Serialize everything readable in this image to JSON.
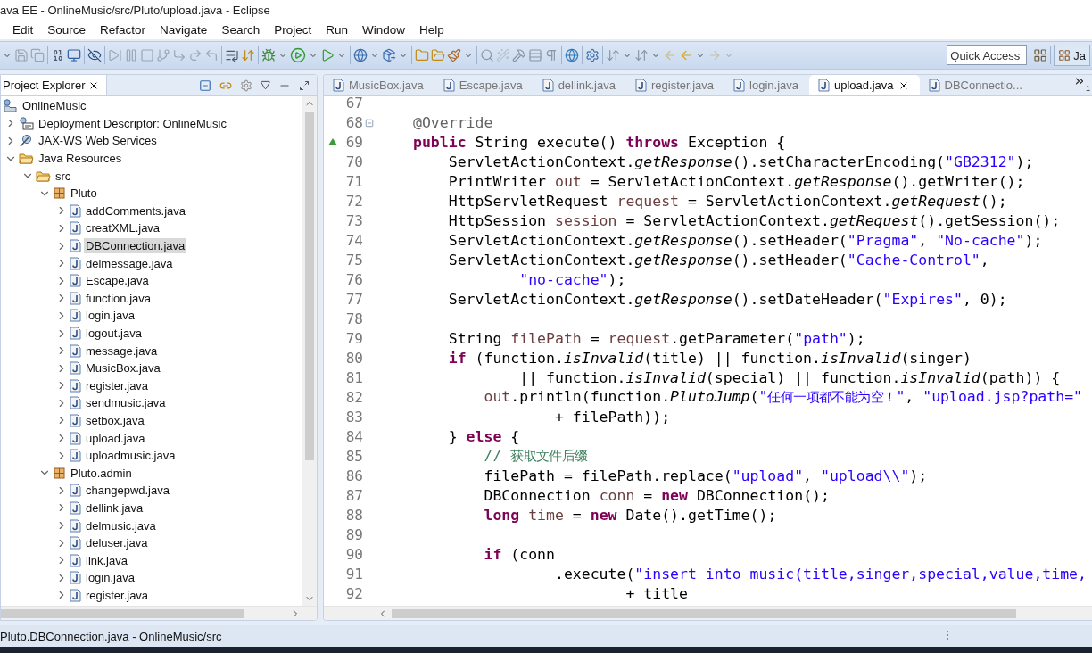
{
  "window": {
    "title": "ava EE - OnlineMusic/src/Pluto/upload.java - Eclipse"
  },
  "menu": [
    "Edit",
    "Source",
    "Refactor",
    "Navigate",
    "Search",
    "Project",
    "Run",
    "Window",
    "Help"
  ],
  "toolbar": {
    "quick_access": {
      "placeholder": "Quick Access"
    },
    "perspective": "Ja"
  },
  "explorer": {
    "title": "Project Explorer",
    "tree": [
      {
        "label": "OnlineMusic",
        "kind": "project",
        "selected": false,
        "children": [
          {
            "label": "Deployment Descriptor: OnlineMusic",
            "kind": "descriptor",
            "expanded": false,
            "selected": false
          },
          {
            "label": "JAX-WS Web Services",
            "kind": "services",
            "expanded": false,
            "selected": false
          },
          {
            "label": "Java Resources",
            "kind": "resources",
            "expanded": true,
            "selected": false,
            "children": [
              {
                "label": "src",
                "kind": "folder",
                "expanded": true,
                "selected": false,
                "children": [
                  {
                    "label": "Pluto",
                    "kind": "package",
                    "expanded": true,
                    "selected": false,
                    "children": [
                      {
                        "label": "addComments.java",
                        "kind": "file",
                        "expanded": false,
                        "selected": false
                      },
                      {
                        "label": "creatXML.java",
                        "kind": "file",
                        "expanded": false,
                        "selected": false
                      },
                      {
                        "label": "DBConnection.java",
                        "kind": "file",
                        "expanded": false,
                        "selected": true
                      },
                      {
                        "label": "delmessage.java",
                        "kind": "file",
                        "expanded": false,
                        "selected": false
                      },
                      {
                        "label": "Escape.java",
                        "kind": "file",
                        "expanded": false,
                        "selected": false
                      },
                      {
                        "label": "function.java",
                        "kind": "file",
                        "expanded": false,
                        "selected": false
                      },
                      {
                        "label": "login.java",
                        "kind": "file",
                        "expanded": false,
                        "selected": false
                      },
                      {
                        "label": "logout.java",
                        "kind": "file",
                        "expanded": false,
                        "selected": false
                      },
                      {
                        "label": "message.java",
                        "kind": "file",
                        "expanded": false,
                        "selected": false
                      },
                      {
                        "label": "MusicBox.java",
                        "kind": "file",
                        "expanded": false,
                        "selected": false
                      },
                      {
                        "label": "register.java",
                        "kind": "file",
                        "expanded": false,
                        "selected": false
                      },
                      {
                        "label": "sendmusic.java",
                        "kind": "file",
                        "expanded": false,
                        "selected": false
                      },
                      {
                        "label": "setbox.java",
                        "kind": "file",
                        "expanded": false,
                        "selected": false
                      },
                      {
                        "label": "upload.java",
                        "kind": "file",
                        "expanded": false,
                        "selected": false
                      },
                      {
                        "label": "uploadmusic.java",
                        "kind": "file",
                        "expanded": false,
                        "selected": false
                      }
                    ]
                  },
                  {
                    "label": "Pluto.admin",
                    "kind": "package",
                    "expanded": true,
                    "selected": false,
                    "children": [
                      {
                        "label": "changepwd.java",
                        "kind": "file",
                        "expanded": false,
                        "selected": false
                      },
                      {
                        "label": "dellink.java",
                        "kind": "file",
                        "expanded": false,
                        "selected": false
                      },
                      {
                        "label": "delmusic.java",
                        "kind": "file",
                        "expanded": false,
                        "selected": false
                      },
                      {
                        "label": "deluser.java",
                        "kind": "file",
                        "expanded": false,
                        "selected": false
                      },
                      {
                        "label": "link.java",
                        "kind": "file",
                        "expanded": false,
                        "selected": false
                      },
                      {
                        "label": "login.java",
                        "kind": "file",
                        "expanded": false,
                        "selected": false
                      },
                      {
                        "label": "register.java",
                        "kind": "file",
                        "expanded": false,
                        "selected": false
                      }
                    ]
                  }
                ]
              }
            ]
          }
        ]
      }
    ]
  },
  "editor": {
    "tabs": [
      {
        "label": "MusicBox.java",
        "selected": false
      },
      {
        "label": "Escape.java",
        "selected": false
      },
      {
        "label": "dellink.java",
        "selected": false
      },
      {
        "label": "register.java",
        "selected": false
      },
      {
        "label": "login.java",
        "selected": false
      },
      {
        "label": "upload.java",
        "selected": true
      },
      {
        "label": "DBConnectio...",
        "selected": false
      }
    ],
    "hidden_tabs": "1",
    "lines": [
      {
        "number": "67",
        "kind": "code"
      },
      {
        "number": "68",
        "kind": "fold",
        "tokens": [
          {
            "kind": "annotation",
            "text": "@Override"
          }
        ]
      },
      {
        "number": "69",
        "kind": "override",
        "tokens": [
          {
            "kind": "keyword",
            "text": "public"
          },
          {
            "kind": "plain",
            "text": " String execute() "
          },
          {
            "kind": "keyword",
            "text": "throws"
          },
          {
            "kind": "plain",
            "text": " Exception {"
          }
        ]
      },
      {
        "number": "70",
        "kind": "code",
        "tokens": [
          {
            "kind": "plain",
            "text": "    ServletActionContext."
          },
          {
            "kind": "static",
            "text": "getResponse"
          },
          {
            "kind": "plain",
            "text": "().setCharacterEncoding("
          },
          {
            "kind": "string",
            "text": "\"GB2312\""
          },
          {
            "kind": "plain",
            "text": ");"
          }
        ]
      },
      {
        "number": "71",
        "kind": "code",
        "tokens": [
          {
            "kind": "plain",
            "text": "    PrintWriter "
          },
          {
            "kind": "variable",
            "text": "out"
          },
          {
            "kind": "plain",
            "text": " = ServletActionContext."
          },
          {
            "kind": "static",
            "text": "getResponse"
          },
          {
            "kind": "plain",
            "text": "().getWriter();"
          }
        ]
      },
      {
        "number": "72",
        "kind": "code",
        "tokens": [
          {
            "kind": "plain",
            "text": "    HttpServletRequest "
          },
          {
            "kind": "variable",
            "text": "request"
          },
          {
            "kind": "plain",
            "text": " = ServletActionContext."
          },
          {
            "kind": "static",
            "text": "getRequest"
          },
          {
            "kind": "plain",
            "text": "();"
          }
        ]
      },
      {
        "number": "73",
        "kind": "code",
        "tokens": [
          {
            "kind": "plain",
            "text": "    HttpSession "
          },
          {
            "kind": "variable",
            "text": "session"
          },
          {
            "kind": "plain",
            "text": " = ServletActionContext."
          },
          {
            "kind": "static",
            "text": "getRequest"
          },
          {
            "kind": "plain",
            "text": "().getSession();"
          }
        ]
      },
      {
        "number": "74",
        "kind": "code",
        "tokens": [
          {
            "kind": "plain",
            "text": "    ServletActionContext."
          },
          {
            "kind": "static",
            "text": "getResponse"
          },
          {
            "kind": "plain",
            "text": "().setHeader("
          },
          {
            "kind": "string",
            "text": "\"Pragma\""
          },
          {
            "kind": "plain",
            "text": ", "
          },
          {
            "kind": "string",
            "text": "\"No-cache\""
          },
          {
            "kind": "plain",
            "text": ");"
          }
        ]
      },
      {
        "number": "75",
        "kind": "code",
        "tokens": [
          {
            "kind": "plain",
            "text": "    ServletActionContext."
          },
          {
            "kind": "static",
            "text": "getResponse"
          },
          {
            "kind": "plain",
            "text": "().setHeader("
          },
          {
            "kind": "string",
            "text": "\"Cache-Control\""
          },
          {
            "kind": "plain",
            "text": ","
          }
        ]
      },
      {
        "number": "76",
        "kind": "code",
        "tokens": [
          {
            "kind": "string",
            "text": "            \"no-cache\""
          },
          {
            "kind": "plain",
            "text": ");"
          }
        ]
      },
      {
        "number": "77",
        "kind": "code",
        "tokens": [
          {
            "kind": "plain",
            "text": "    ServletActionContext."
          },
          {
            "kind": "static",
            "text": "getResponse"
          },
          {
            "kind": "plain",
            "text": "().setDateHeader("
          },
          {
            "kind": "string",
            "text": "\"Expires\""
          },
          {
            "kind": "plain",
            "text": ", 0);"
          }
        ]
      },
      {
        "number": "78",
        "kind": "code"
      },
      {
        "number": "79",
        "kind": "code",
        "tokens": [
          {
            "kind": "plain",
            "text": "    String "
          },
          {
            "kind": "variable",
            "text": "filePath"
          },
          {
            "kind": "plain",
            "text": " = "
          },
          {
            "kind": "variable",
            "text": "request"
          },
          {
            "kind": "plain",
            "text": ".getParameter("
          },
          {
            "kind": "string",
            "text": "\"path\""
          },
          {
            "kind": "plain",
            "text": ");"
          }
        ]
      },
      {
        "number": "80",
        "kind": "code",
        "tokens": [
          {
            "kind": "keyword",
            "text": "    if"
          },
          {
            "kind": "plain",
            "text": " (function."
          },
          {
            "kind": "static",
            "text": "isInvalid"
          },
          {
            "kind": "plain",
            "text": "(title) || function."
          },
          {
            "kind": "static",
            "text": "isInvalid"
          },
          {
            "kind": "plain",
            "text": "(singer)"
          }
        ]
      },
      {
        "number": "81",
        "kind": "code",
        "tokens": [
          {
            "kind": "plain",
            "text": "            || function."
          },
          {
            "kind": "static",
            "text": "isInvalid"
          },
          {
            "kind": "plain",
            "text": "(special) || function."
          },
          {
            "kind": "static",
            "text": "isInvalid"
          },
          {
            "kind": "plain",
            "text": "(path)) {"
          }
        ]
      },
      {
        "number": "82",
        "kind": "code",
        "tokens": [
          {
            "kind": "variable",
            "text": "        out"
          },
          {
            "kind": "plain",
            "text": ".println(function."
          },
          {
            "kind": "static",
            "text": "PlutoJump"
          },
          {
            "kind": "plain",
            "text": "("
          },
          {
            "kind": "string",
            "text": "\"任何一项都不能为空！\""
          },
          {
            "kind": "plain",
            "text": ", "
          },
          {
            "kind": "string",
            "text": "\"upload.jsp?path=\""
          }
        ]
      },
      {
        "number": "83",
        "kind": "code",
        "tokens": [
          {
            "kind": "plain",
            "text": "                + filePath));"
          }
        ]
      },
      {
        "number": "84",
        "kind": "code",
        "tokens": [
          {
            "kind": "plain",
            "text": "    } "
          },
          {
            "kind": "keyword",
            "text": "else"
          },
          {
            "kind": "plain",
            "text": " {"
          }
        ]
      },
      {
        "number": "85",
        "kind": "code",
        "tokens": [
          {
            "kind": "comment",
            "text": "        // 获取文件后缀"
          }
        ]
      },
      {
        "number": "86",
        "kind": "code",
        "tokens": [
          {
            "kind": "plain",
            "text": "        filePath = filePath.replace("
          },
          {
            "kind": "string",
            "text": "\"upload\""
          },
          {
            "kind": "plain",
            "text": ", "
          },
          {
            "kind": "string",
            "text": "\"upload\\\\\""
          },
          {
            "kind": "plain",
            "text": ");"
          }
        ]
      },
      {
        "number": "87",
        "kind": "code",
        "tokens": [
          {
            "kind": "plain",
            "text": "        DBConnection "
          },
          {
            "kind": "variable",
            "text": "conn"
          },
          {
            "kind": "plain",
            "text": " = "
          },
          {
            "kind": "keyword",
            "text": "new"
          },
          {
            "kind": "plain",
            "text": " DBConnection();"
          }
        ]
      },
      {
        "number": "88",
        "kind": "code",
        "tokens": [
          {
            "kind": "keyword",
            "text": "        long"
          },
          {
            "kind": "variable",
            "text": " time"
          },
          {
            "kind": "plain",
            "text": " = "
          },
          {
            "kind": "keyword",
            "text": "new"
          },
          {
            "kind": "plain",
            "text": " Date().getTime();"
          }
        ]
      },
      {
        "number": "89",
        "kind": "code"
      },
      {
        "number": "90",
        "kind": "code",
        "tokens": [
          {
            "kind": "keyword",
            "text": "        if"
          },
          {
            "kind": "plain",
            "text": " (conn"
          }
        ]
      },
      {
        "number": "91",
        "kind": "code",
        "tokens": [
          {
            "kind": "plain",
            "text": "                .execute("
          },
          {
            "kind": "string",
            "text": "\"insert into music(title,singer,special,value,time,"
          }
        ]
      },
      {
        "number": "92",
        "kind": "code",
        "tokens": [
          {
            "kind": "plain",
            "text": "                        + title"
          }
        ]
      }
    ]
  },
  "status_bar": {
    "text": "Pluto.DBConnection.java - OnlineMusic/src"
  }
}
